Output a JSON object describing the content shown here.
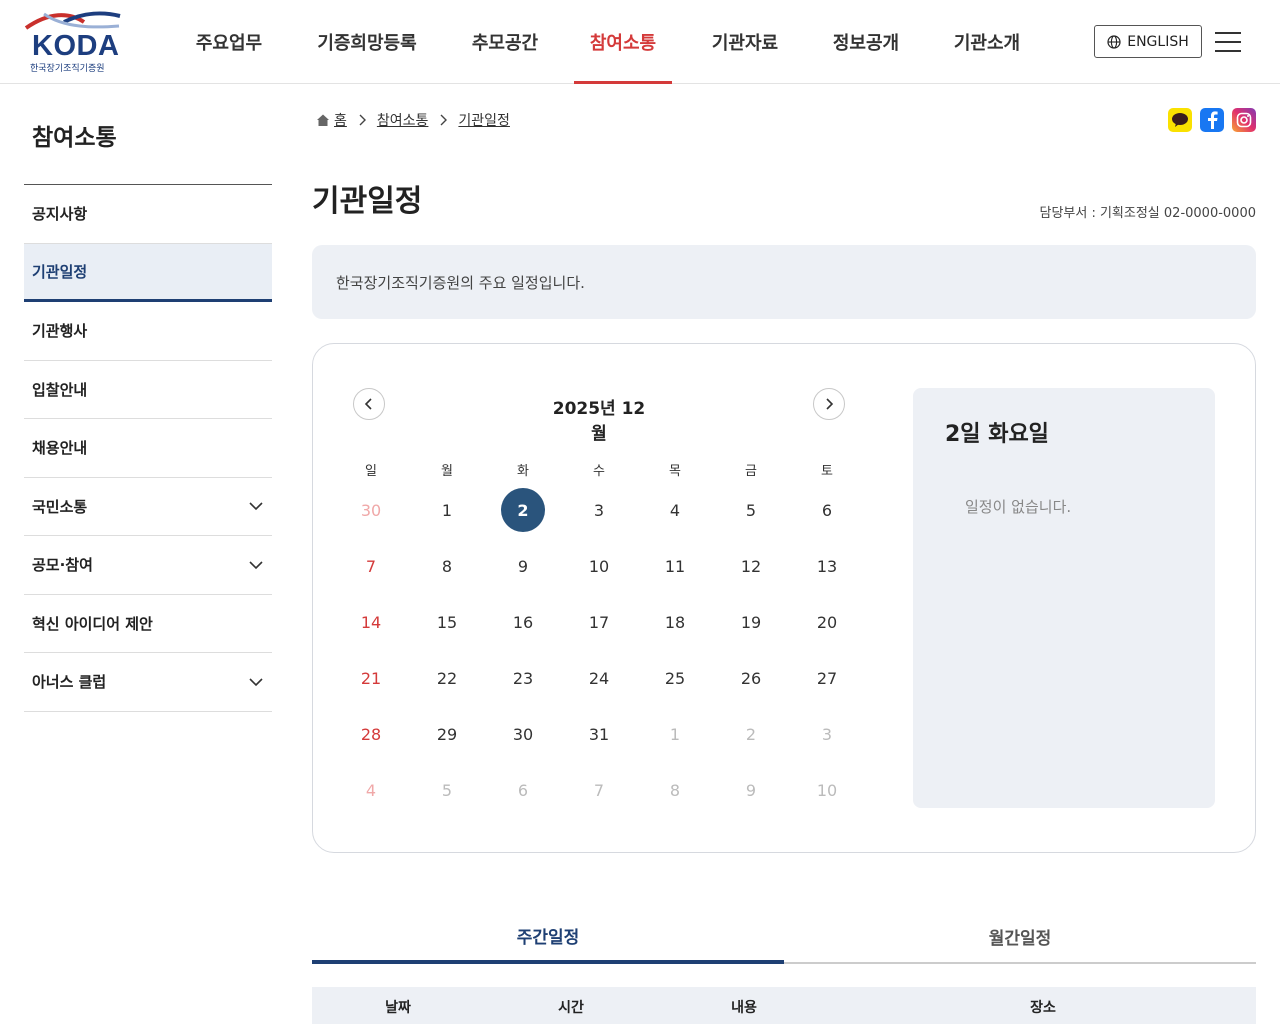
{
  "header": {
    "logo_text": "KODA",
    "logo_sub": "한국장기조직기증원",
    "nav": [
      "주요업무",
      "기증희망등록",
      "추모공간",
      "참여소통",
      "기관자료",
      "정보공개",
      "기관소개"
    ],
    "active_nav_index": 3,
    "english_label": "ENGLISH",
    "accent_color": "#d43a3a",
    "brand_color": "#1d3e7f"
  },
  "sidebar": {
    "title": "참여소통",
    "items": [
      {
        "label": "공지사항",
        "expandable": false
      },
      {
        "label": "기관일정",
        "expandable": false,
        "active": true
      },
      {
        "label": "기관행사",
        "expandable": false
      },
      {
        "label": "입찰안내",
        "expandable": false
      },
      {
        "label": "채용안내",
        "expandable": false
      },
      {
        "label": "국민소통",
        "expandable": true
      },
      {
        "label": "공모·참여",
        "expandable": true
      },
      {
        "label": "혁신 아이디어 제안",
        "expandable": false
      },
      {
        "label": "아너스 클럽",
        "expandable": true
      }
    ]
  },
  "breadcrumb": [
    "홈",
    "참여소통",
    "기관일정"
  ],
  "sns_icons": [
    "kakao-icon",
    "facebook-icon",
    "instagram-icon"
  ],
  "page": {
    "title": "기관일정",
    "dept": "담당부서 : 기획조정실 02-0000-0000",
    "intro": "한국장기조직기증원의 주요 일정입니다."
  },
  "calendar": {
    "month_label": "2025년 12월",
    "weekdays": [
      "일",
      "월",
      "화",
      "수",
      "목",
      "금",
      "토"
    ],
    "weeks": [
      [
        "30",
        "1",
        "2",
        "3",
        "4",
        "5",
        "6"
      ],
      [
        "7",
        "8",
        "9",
        "10",
        "11",
        "12",
        "13"
      ],
      [
        "14",
        "15",
        "16",
        "17",
        "18",
        "19",
        "20"
      ],
      [
        "21",
        "22",
        "23",
        "24",
        "25",
        "26",
        "27"
      ],
      [
        "28",
        "29",
        "30",
        "31",
        "1",
        "2",
        "3"
      ],
      [
        "4",
        "5",
        "6",
        "7",
        "8",
        "9",
        "10"
      ]
    ],
    "selected_day": "2",
    "selected_label": "2일 화요일",
    "empty_message": "일정이 없습니다.",
    "selected_color": "#2a547c"
  },
  "tabs": [
    "주간일정",
    "월간일정"
  ],
  "active_tab_index": 0,
  "table_headers": [
    "날짜",
    "시간",
    "내용",
    "장소"
  ]
}
